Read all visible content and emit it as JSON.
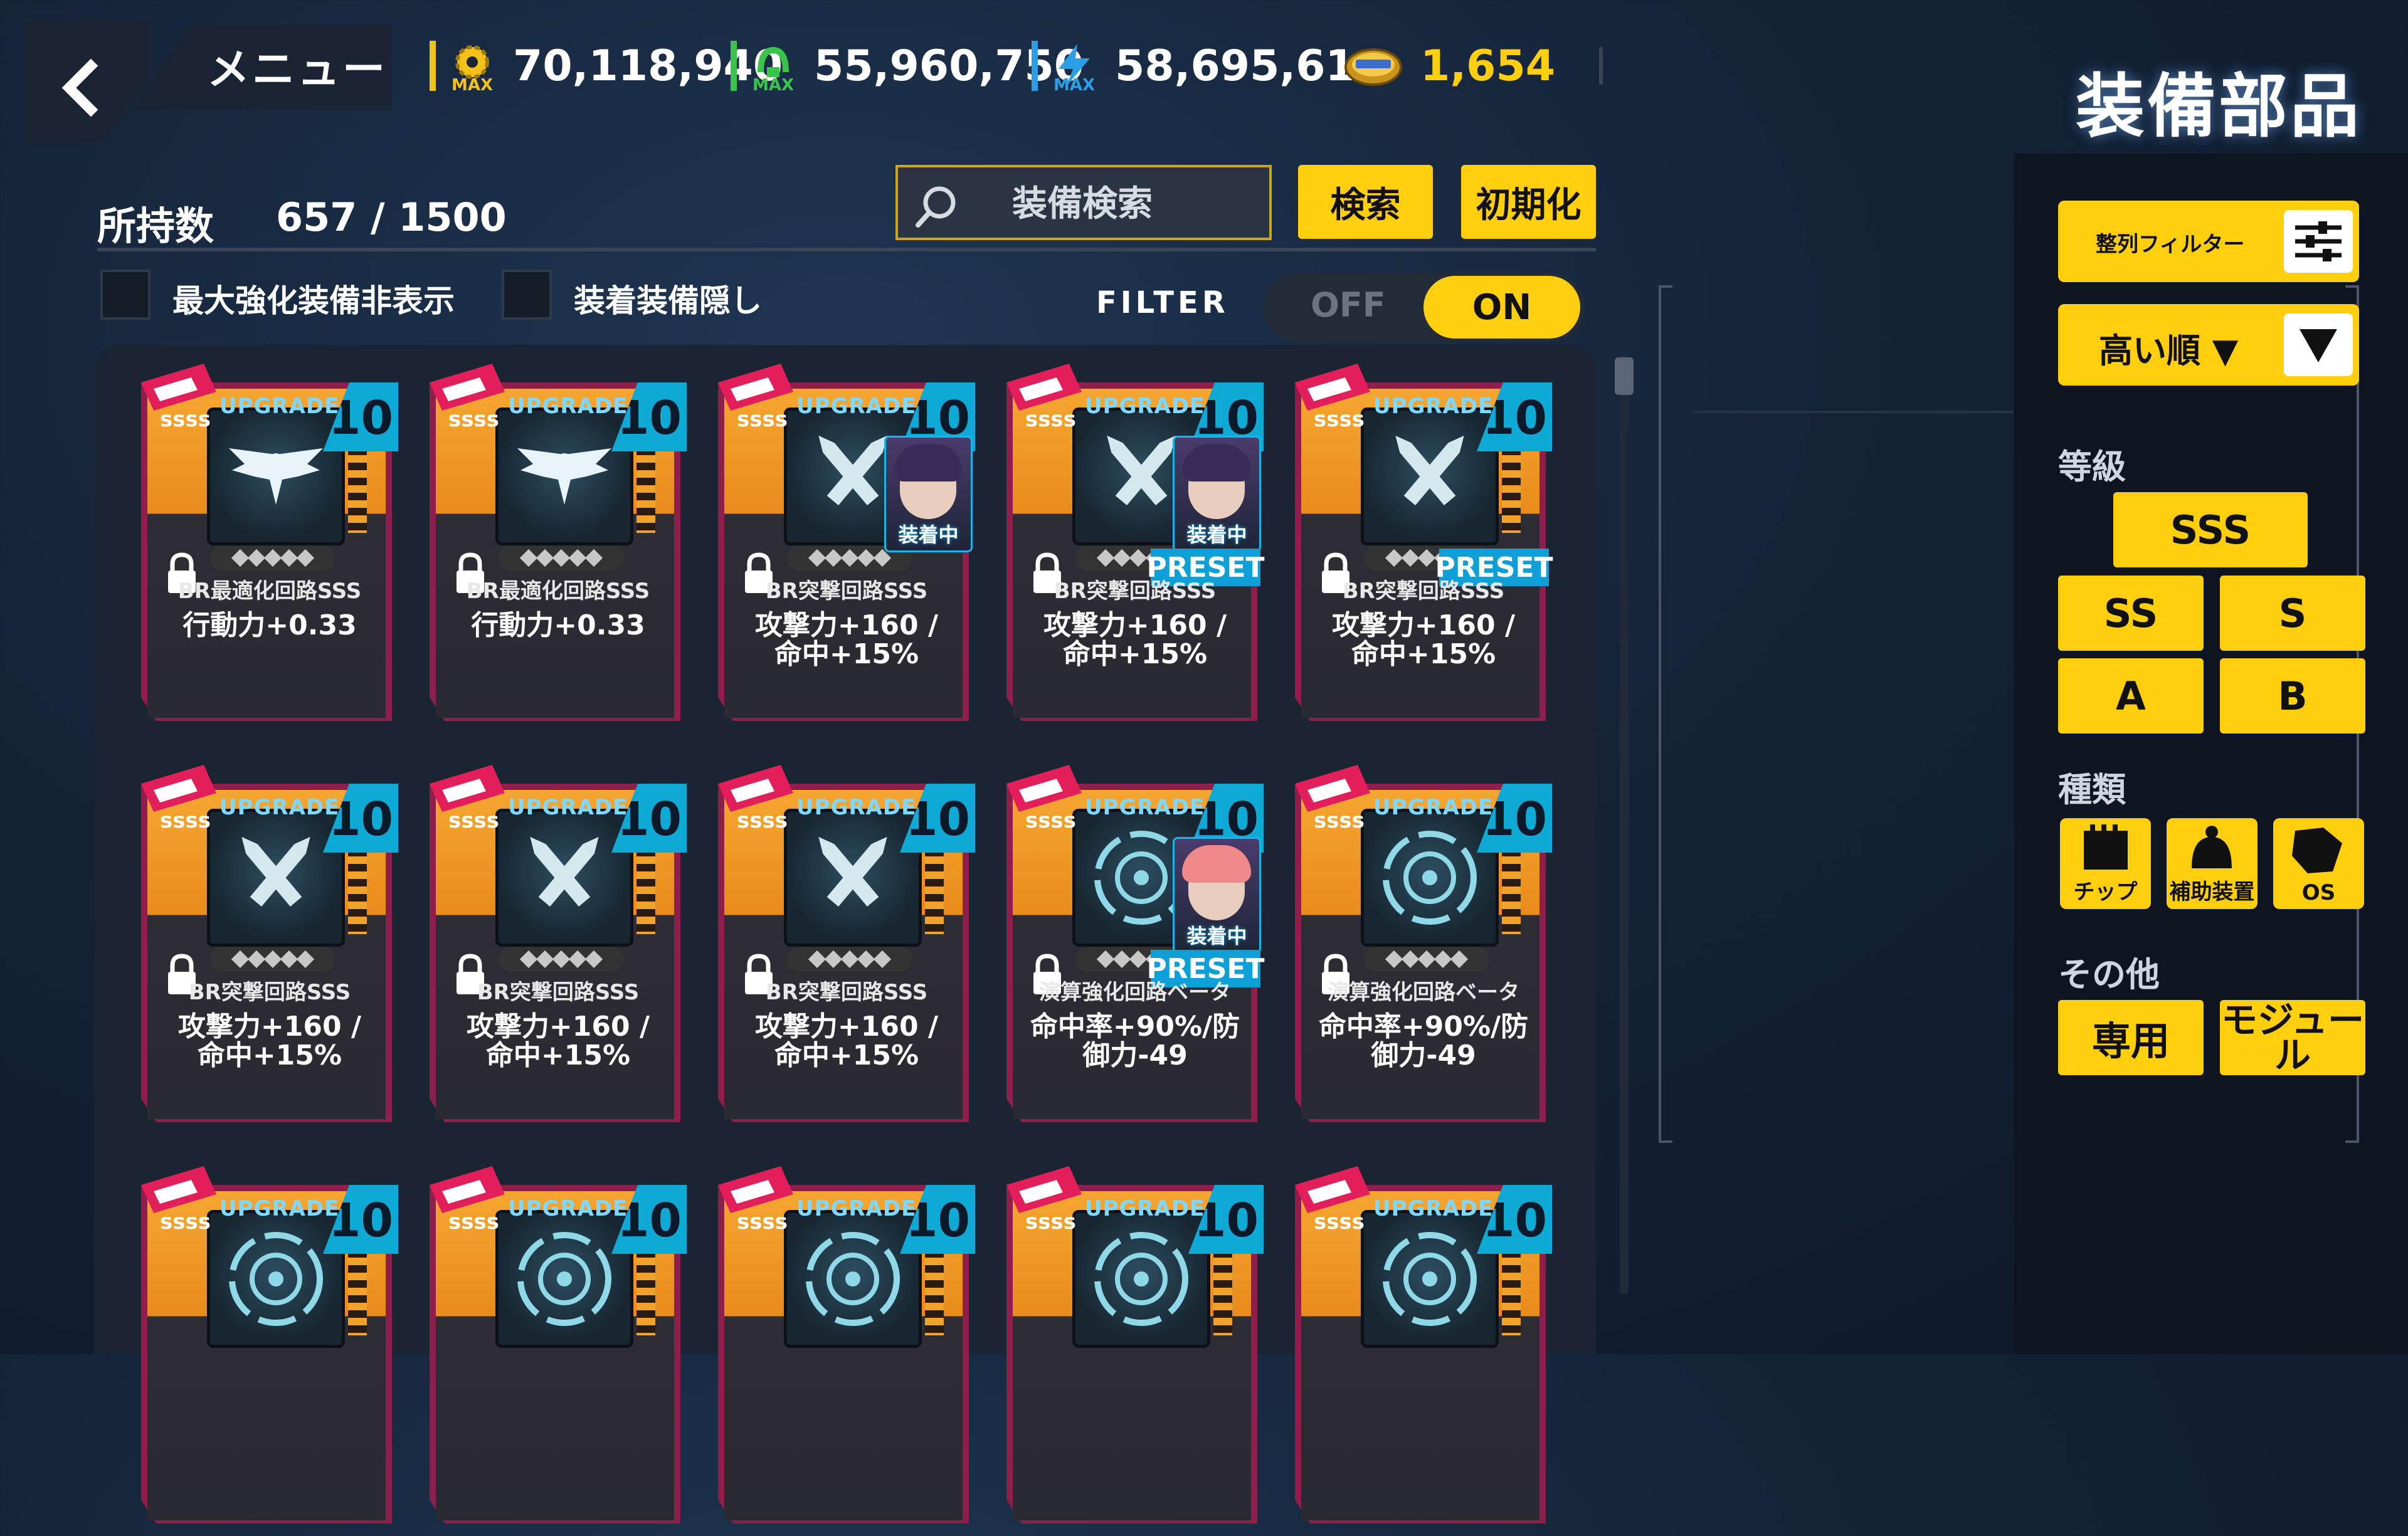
{
  "header": {
    "menu_label": "メニュー",
    "title": "装備部品",
    "resources": [
      {
        "icon": "gear-max-icon",
        "badge": "MAX",
        "value": "70,118,940",
        "color": "#f2c21a"
      },
      {
        "icon": "green-max-icon",
        "badge": "MAX",
        "value": "55,960,750",
        "color": "#39c44a"
      },
      {
        "icon": "blue-max-icon",
        "badge": "MAX",
        "value": "58,695,610",
        "color": "#2a9fe8"
      },
      {
        "icon": "coin-icon",
        "value": "1,654",
        "color": "#ffcf0e"
      }
    ]
  },
  "inventory": {
    "count_label": "所持数",
    "count_value": "657 / 1500",
    "search_placeholder": "装備検索",
    "search_button": "検索",
    "reset_button": "初期化",
    "hide_max_label": "最大強化装備非表示",
    "hide_equipped_label": "装着装備隠し",
    "filter_label": "FILTER",
    "toggle_off": "OFF",
    "toggle_on": "ON"
  },
  "cards_row1": [
    {
      "upgrade": "UPGRADE",
      "level": "10",
      "art": "eagle",
      "name": "BR最適化回路SSS",
      "stat1": "行動力+0.33",
      "stat2": "",
      "equipped": false,
      "preset": false
    },
    {
      "upgrade": "UPGRADE",
      "level": "10",
      "art": "eagle",
      "name": "BR最適化回路SSS",
      "stat1": "行動力+0.33",
      "stat2": "",
      "equipped": false,
      "preset": false
    },
    {
      "upgrade": "UPGRADE",
      "level": "10",
      "art": "bullets",
      "name": "BR突撃回路SSS",
      "stat1": "攻撃力+160 /",
      "stat2": "命中+15%",
      "equipped": true,
      "equipped_label": "装着中",
      "preset": false
    },
    {
      "upgrade": "UPGRADE",
      "level": "10",
      "art": "bullets",
      "name": "BR突撃回路SSS",
      "stat1": "攻撃力+160 /",
      "stat2": "命中+15%",
      "equipped": true,
      "equipped_label": "装着中",
      "preset": true,
      "preset_label": "PRESET"
    },
    {
      "upgrade": "UPGRADE",
      "level": "10",
      "art": "bullets",
      "name": "BR突撃回路SSS",
      "stat1": "攻撃力+160 /",
      "stat2": "命中+15%",
      "equipped": false,
      "preset": true,
      "preset_label": "PRESET"
    }
  ],
  "cards_row2": [
    {
      "upgrade": "UPGRADE",
      "level": "10",
      "art": "bullets",
      "name": "BR突撃回路SSS",
      "stat1": "攻撃力+160 /",
      "stat2": "命中+15%",
      "equipped": false,
      "preset": false
    },
    {
      "upgrade": "UPGRADE",
      "level": "10",
      "art": "bullets",
      "name": "BR突撃回路SSS",
      "stat1": "攻撃力+160 /",
      "stat2": "命中+15%",
      "equipped": false,
      "preset": false
    },
    {
      "upgrade": "UPGRADE",
      "level": "10",
      "art": "bullets",
      "name": "BR突撃回路SSS",
      "stat1": "攻撃力+160 /",
      "stat2": "命中+15%",
      "equipped": false,
      "preset": false
    },
    {
      "upgrade": "UPGRADE",
      "level": "10",
      "art": "beta",
      "name": "演算強化回路ベータ",
      "stat1": "命中率+90%/防御力-49",
      "stat2": "",
      "equipped": true,
      "equipped_label": "装着中",
      "preset": true,
      "preset_label": "PRESET"
    },
    {
      "upgrade": "UPGRADE",
      "level": "10",
      "art": "beta",
      "name": "演算強化回路ベータ",
      "stat1": "命中率+90%/防御力-49",
      "stat2": "",
      "equipped": false,
      "preset": false
    }
  ],
  "cards_row3": [
    {
      "upgrade": "UPGRADE",
      "level": "10"
    },
    {
      "upgrade": "UPGRADE",
      "level": "10"
    },
    {
      "upgrade": "UPGRADE",
      "level": "10"
    },
    {
      "upgrade": "UPGRADE",
      "level": "10"
    },
    {
      "upgrade": "UPGRADE",
      "level": "10"
    }
  ],
  "sidebar": {
    "sort_filter_label": "整列フィルター",
    "sort_order_label": "高い順 ▼",
    "grade_title": "等級",
    "grades": [
      "SSS",
      "SS",
      "S",
      "A",
      "B"
    ],
    "type_title": "種類",
    "types": [
      {
        "icon": "chip-icon",
        "label": "チップ"
      },
      {
        "icon": "support-device-icon",
        "label": "補助装置"
      },
      {
        "icon": "os-icon",
        "label": "OS"
      }
    ],
    "other_title": "その他",
    "others": [
      "専用",
      "モジュール"
    ]
  }
}
